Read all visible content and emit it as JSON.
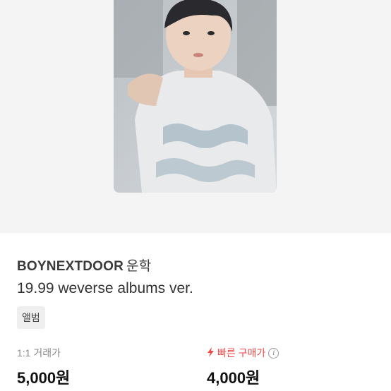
{
  "product": {
    "artist": "BOYNEXTDOOR",
    "member": "운학",
    "album": "19.99 weverse albums ver.",
    "category_tag": "앨범"
  },
  "prices": {
    "normal": {
      "label": "1:1 거래가",
      "value": "5,000원"
    },
    "fast": {
      "label": "빠른 구매가",
      "value": "4,000원",
      "icon": "lightning-icon",
      "info_icon": "info-icon"
    }
  },
  "colors": {
    "accent": "#f04a4a",
    "hero_bg": "#f4f4f4"
  }
}
